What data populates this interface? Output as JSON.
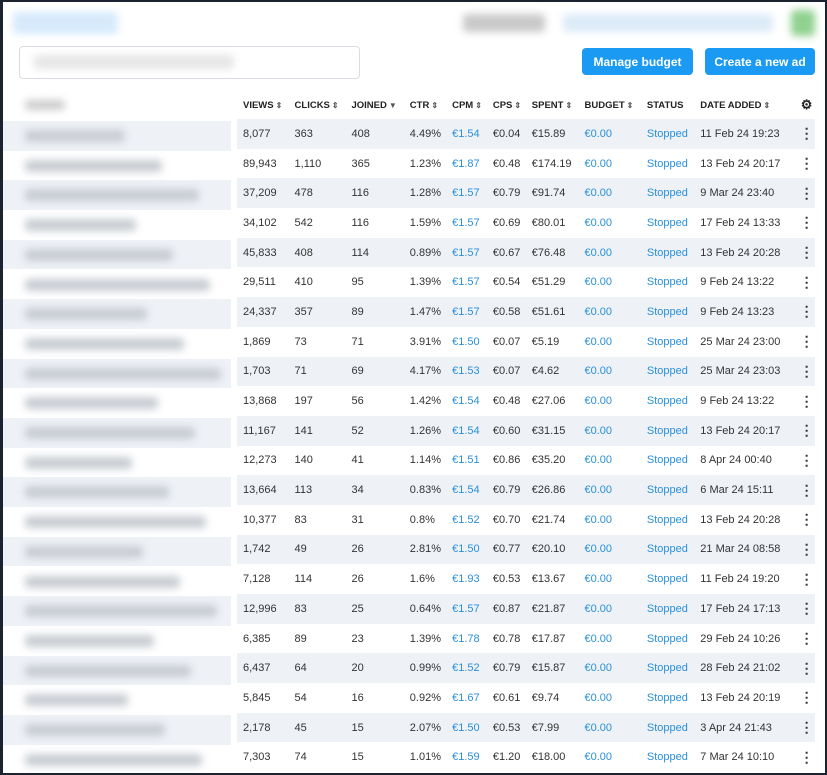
{
  "toolbar": {
    "manage_budget_label": "Manage budget",
    "create_ad_label": "Create a new ad"
  },
  "colors": {
    "accent": "#1a9af2",
    "link": "#2a8fd8",
    "row_alt": "#eef2f7"
  },
  "table": {
    "columns": [
      {
        "label": "VIEWS",
        "sort": "both"
      },
      {
        "label": "CLICKS",
        "sort": "both"
      },
      {
        "label": "JOINED",
        "sort": "desc"
      },
      {
        "label": "CTR",
        "sort": "both"
      },
      {
        "label": "CPM",
        "sort": "both"
      },
      {
        "label": "CPS",
        "sort": "both"
      },
      {
        "label": "SPENT",
        "sort": "both"
      },
      {
        "label": "BUDGET",
        "sort": "both"
      },
      {
        "label": "STATUS",
        "sort": "none"
      },
      {
        "label": "DATE ADDED",
        "sort": "both"
      }
    ],
    "settings_icon": "gear-icon",
    "row_menu_icon": "kebab-icon",
    "rows": [
      [
        "8,077",
        "363",
        "408",
        "4.49%",
        "€1.54",
        "€0.04",
        "€15.89",
        "€0.00",
        "Stopped",
        "11 Feb 24 19:23"
      ],
      [
        "89,943",
        "1,110",
        "365",
        "1.23%",
        "€1.87",
        "€0.48",
        "€174.19",
        "€0.00",
        "Stopped",
        "13 Feb 24 20:17"
      ],
      [
        "37,209",
        "478",
        "116",
        "1.28%",
        "€1.57",
        "€0.79",
        "€91.74",
        "€0.00",
        "Stopped",
        "9 Mar 24 23:40"
      ],
      [
        "34,102",
        "542",
        "116",
        "1.59%",
        "€1.57",
        "€0.69",
        "€80.01",
        "€0.00",
        "Stopped",
        "17 Feb 24 13:33"
      ],
      [
        "45,833",
        "408",
        "114",
        "0.89%",
        "€1.57",
        "€0.67",
        "€76.48",
        "€0.00",
        "Stopped",
        "13 Feb 24 20:28"
      ],
      [
        "29,511",
        "410",
        "95",
        "1.39%",
        "€1.57",
        "€0.54",
        "€51.29",
        "€0.00",
        "Stopped",
        "9 Feb 24 13:22"
      ],
      [
        "24,337",
        "357",
        "89",
        "1.47%",
        "€1.57",
        "€0.58",
        "€51.61",
        "€0.00",
        "Stopped",
        "9 Feb 24 13:23"
      ],
      [
        "1,869",
        "73",
        "71",
        "3.91%",
        "€1.50",
        "€0.07",
        "€5.19",
        "€0.00",
        "Stopped",
        "25 Mar 24 23:00"
      ],
      [
        "1,703",
        "71",
        "69",
        "4.17%",
        "€1.53",
        "€0.07",
        "€4.62",
        "€0.00",
        "Stopped",
        "25 Mar 24 23:03"
      ],
      [
        "13,868",
        "197",
        "56",
        "1.42%",
        "€1.54",
        "€0.48",
        "€27.06",
        "€0.00",
        "Stopped",
        "9 Feb 24 13:22"
      ],
      [
        "11,167",
        "141",
        "52",
        "1.26%",
        "€1.54",
        "€0.60",
        "€31.15",
        "€0.00",
        "Stopped",
        "13 Feb 24 20:17"
      ],
      [
        "12,273",
        "140",
        "41",
        "1.14%",
        "€1.51",
        "€0.86",
        "€35.20",
        "€0.00",
        "Stopped",
        "8 Apr 24 00:40"
      ],
      [
        "13,664",
        "113",
        "34",
        "0.83%",
        "€1.54",
        "€0.79",
        "€26.86",
        "€0.00",
        "Stopped",
        "6 Mar 24 15:11"
      ],
      [
        "10,377",
        "83",
        "31",
        "0.8%",
        "€1.52",
        "€0.70",
        "€21.74",
        "€0.00",
        "Stopped",
        "13 Feb 24 20:28"
      ],
      [
        "1,742",
        "49",
        "26",
        "2.81%",
        "€1.50",
        "€0.77",
        "€20.10",
        "€0.00",
        "Stopped",
        "21 Mar 24 08:58"
      ],
      [
        "7,128",
        "114",
        "26",
        "1.6%",
        "€1.93",
        "€0.53",
        "€13.67",
        "€0.00",
        "Stopped",
        "11 Feb 24 19:20"
      ],
      [
        "12,996",
        "83",
        "25",
        "0.64%",
        "€1.57",
        "€0.87",
        "€21.87",
        "€0.00",
        "Stopped",
        "17 Feb 24 17:13"
      ],
      [
        "6,385",
        "89",
        "23",
        "1.39%",
        "€1.78",
        "€0.78",
        "€17.87",
        "€0.00",
        "Stopped",
        "29 Feb 24 10:26"
      ],
      [
        "6,437",
        "64",
        "20",
        "0.99%",
        "€1.52",
        "€0.79",
        "€15.87",
        "€0.00",
        "Stopped",
        "28 Feb 24 21:02"
      ],
      [
        "5,845",
        "54",
        "16",
        "0.92%",
        "€1.67",
        "€0.61",
        "€9.74",
        "€0.00",
        "Stopped",
        "13 Feb 24 20:19"
      ],
      [
        "2,178",
        "45",
        "15",
        "2.07%",
        "€1.50",
        "€0.53",
        "€7.99",
        "€0.00",
        "Stopped",
        "3 Apr 24 21:43"
      ],
      [
        "7,303",
        "74",
        "15",
        "1.01%",
        "€1.59",
        "€1.20",
        "€18.00",
        "€0.00",
        "Stopped",
        "7 Mar 24 10:10"
      ]
    ]
  }
}
